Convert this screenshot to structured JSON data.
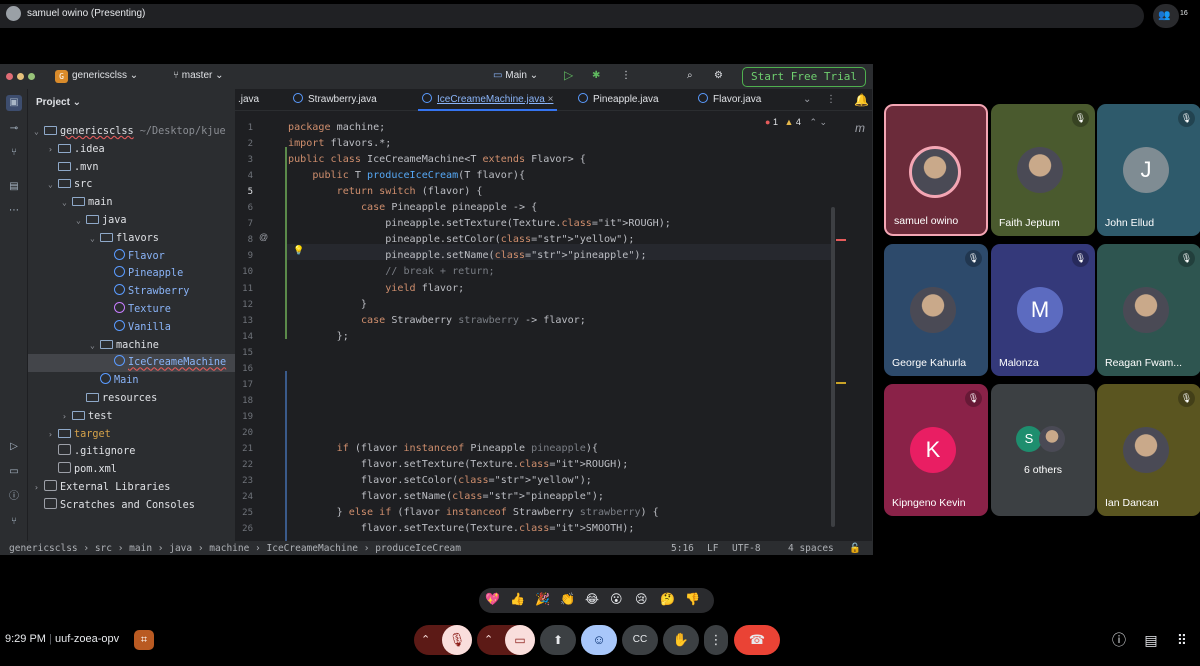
{
  "topbar": {
    "presenter": "samuel owino (Presenting)",
    "people_count": "16"
  },
  "ide": {
    "project": "genericsclss",
    "branch": "master",
    "run_config": "Main",
    "trial_button": "Start Free Trial",
    "tree_header": "Project",
    "tree": [
      {
        "indent": 0,
        "arrow": "⌄",
        "icon": "folder",
        "label": "genericsclss",
        "extra": "  ~/Desktop/kjue"
      },
      {
        "indent": 1,
        "arrow": "›",
        "icon": "folder",
        "label": ".idea",
        "extra": ""
      },
      {
        "indent": 1,
        "arrow": "",
        "icon": "folder",
        "label": ".mvn",
        "extra": ""
      },
      {
        "indent": 1,
        "arrow": "⌄",
        "icon": "folder",
        "label": "src",
        "extra": ""
      },
      {
        "indent": 2,
        "arrow": "⌄",
        "icon": "folder",
        "label": "main",
        "extra": ""
      },
      {
        "indent": 3,
        "arrow": "⌄",
        "icon": "folder",
        "label": "java",
        "extra": ""
      },
      {
        "indent": 4,
        "arrow": "⌄",
        "icon": "folder",
        "label": "flavors",
        "extra": ""
      },
      {
        "indent": 5,
        "arrow": "",
        "icon": "cls",
        "label": "Flavor",
        "extra": ""
      },
      {
        "indent": 5,
        "arrow": "",
        "icon": "cls",
        "label": "Pineapple",
        "extra": ""
      },
      {
        "indent": 5,
        "arrow": "",
        "icon": "cls",
        "label": "Strawberry",
        "extra": ""
      },
      {
        "indent": 5,
        "arrow": "",
        "icon": "enm",
        "label": "Texture",
        "extra": ""
      },
      {
        "indent": 5,
        "arrow": "",
        "icon": "cls",
        "label": "Vanilla",
        "extra": ""
      },
      {
        "indent": 4,
        "arrow": "⌄",
        "icon": "folder",
        "label": "machine",
        "extra": ""
      },
      {
        "indent": 5,
        "arrow": "",
        "icon": "cls",
        "label": "IceCreameMachine",
        "extra": ""
      },
      {
        "indent": 4,
        "arrow": "",
        "icon": "cls",
        "label": "Main",
        "extra": ""
      },
      {
        "indent": 3,
        "arrow": "",
        "icon": "folder",
        "label": "resources",
        "extra": ""
      },
      {
        "indent": 2,
        "arrow": "›",
        "icon": "folder",
        "label": "test",
        "extra": ""
      },
      {
        "indent": 1,
        "arrow": "›",
        "icon": "folder",
        "label": "target",
        "extra": ""
      },
      {
        "indent": 1,
        "arrow": "",
        "icon": "file",
        "label": ".gitignore",
        "extra": ""
      },
      {
        "indent": 1,
        "arrow": "",
        "icon": "file",
        "label": "pom.xml",
        "extra": ""
      },
      {
        "indent": 0,
        "arrow": "›",
        "icon": "lib",
        "label": "External Libraries",
        "extra": ""
      },
      {
        "indent": 0,
        "arrow": "",
        "icon": "lib",
        "label": "Scratches and Consoles",
        "extra": ""
      }
    ],
    "tabs": [
      ".java",
      "Strawberry.java",
      "IceCreameMachine.java",
      "Pineapple.java",
      "Flavor.java"
    ],
    "errors": "1",
    "warnings": "4",
    "line_numbers": [
      "1",
      "2",
      "3",
      "4",
      "5",
      "6",
      "7",
      "8",
      "9",
      "10",
      "11",
      "12",
      "13",
      "14",
      "15",
      "16",
      "17",
      "18",
      "19",
      "20",
      "21",
      "22",
      "23",
      "24",
      "25",
      "26"
    ],
    "code": [
      "package machine;",
      "import flavors.*;",
      "public class IceCreameMachine<T extends Flavor> {",
      "    public T produceIceCream(T flavor){",
      "        return switch (flavor) {",
      "            case Pineapple pineapple -> {",
      "                pineapple.setTexture(Texture.ROUGH);",
      "                pineapple.setColor(\"yellow\");",
      "                pineapple.setName(\"pineapple\");",
      "                // break + return;",
      "                yield flavor;",
      "            }",
      "            case Strawberry strawberry -> flavor;",
      "        };",
      "",
      "",
      "",
      "",
      "",
      "",
      "        if (flavor instanceof Pineapple pineapple){",
      "            flavor.setTexture(Texture.ROUGH);",
      "            flavor.setColor(\"yellow\");",
      "            flavor.setName(\"pineapple\");",
      "        } else if (flavor instanceof Strawberry strawberry) {",
      "            flavor.setTexture(Texture.SMOOTH);"
    ],
    "status": {
      "breadcrumb": [
        "genericsclss",
        "src",
        "main",
        "java",
        "machine",
        "IceCreameMachine",
        "produceIceCream"
      ],
      "position": "5:16",
      "line_sep": "LF",
      "encoding": "UTF-8",
      "indent": "4 spaces"
    }
  },
  "participants": [
    {
      "name": "samuel owino",
      "type": "photo",
      "bg": "#6b2b3a",
      "muted": false,
      "speaking": true
    },
    {
      "name": "Faith Jeptum",
      "type": "photo",
      "bg": "#4a5a2e",
      "muted": true
    },
    {
      "name": "John Ellud",
      "type": "letter",
      "letter": "J",
      "bg": "#2e5a6b",
      "letter_bg": "#7f8c93",
      "muted": true
    },
    {
      "name": "George Kahurla",
      "type": "photo",
      "bg": "#2d4a6b",
      "muted": true
    },
    {
      "name": "Malonza",
      "type": "letter",
      "letter": "M",
      "bg": "#34397a",
      "letter_bg": "#5c6bc0",
      "muted": true
    },
    {
      "name": "Reagan Fwam...",
      "type": "photo",
      "bg": "#2e5550",
      "muted": true
    },
    {
      "name": "Kipngeno Kevin",
      "type": "letter",
      "letter": "K",
      "bg": "#8a2248",
      "letter_bg": "#e91e63",
      "muted": true
    },
    {
      "name": "6 others",
      "type": "others",
      "bg": "#3c4043",
      "letter": "S"
    },
    {
      "name": "Ian Dancan",
      "type": "photo",
      "bg": "#5a5520",
      "muted": true
    }
  ],
  "reactions": [
    "💖",
    "👍",
    "🎉",
    "👏",
    "😂",
    "😮",
    "😢",
    "🤔",
    "👎"
  ],
  "bottom": {
    "time": "9:29 PM",
    "separator": "|",
    "meeting_code": "uuf-zoea-opv"
  },
  "colors": {
    "accent": "#3574f0",
    "hangup": "#ea4335",
    "muted_btn": "#f9dedc",
    "active_btn": "#a8c7fa"
  }
}
